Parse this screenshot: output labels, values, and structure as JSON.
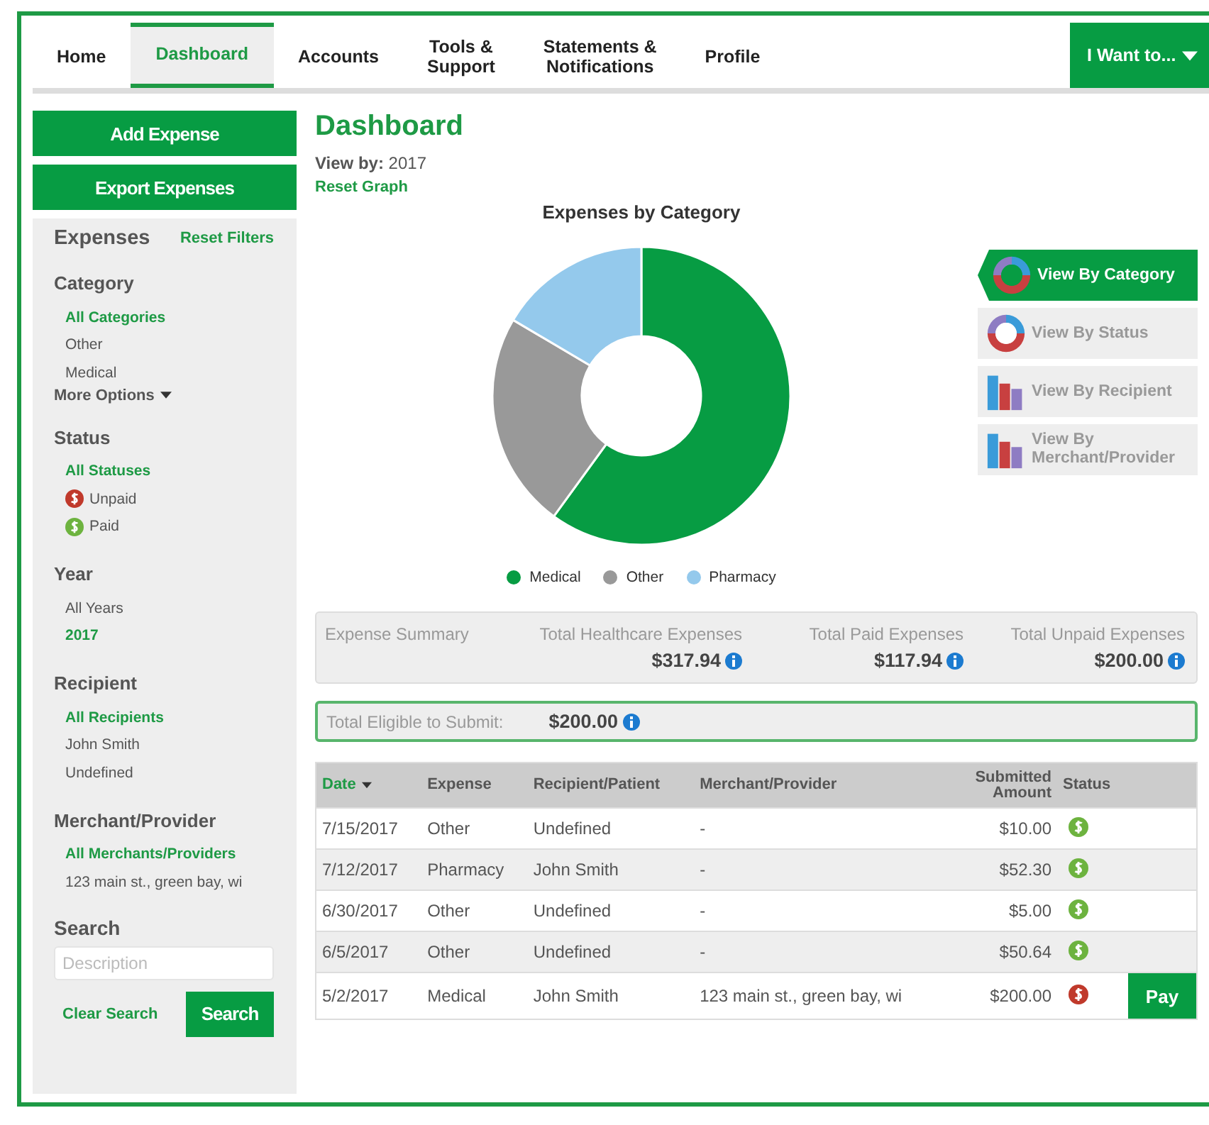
{
  "nav": {
    "tabs": [
      {
        "label": "Home",
        "selected": false
      },
      {
        "label": "Dashboard",
        "selected": true
      },
      {
        "label": "Accounts",
        "selected": false
      },
      {
        "label": "Tools &\nSupport",
        "selected": false
      },
      {
        "label": "Statements &\nNotifications",
        "selected": false
      },
      {
        "label": "Profile",
        "selected": false
      }
    ],
    "menu_button": "I Want to..."
  },
  "sidebar": {
    "actions": [
      "Add Expense",
      "Export Expenses"
    ],
    "title": "Expenses",
    "reset": "Reset Filters",
    "groups": [
      {
        "title": "Category",
        "items": [
          {
            "label": "All Categories",
            "selected": true
          },
          {
            "label": "Other",
            "selected": false
          },
          {
            "label": "Medical",
            "selected": false
          }
        ],
        "more": "More Options"
      },
      {
        "title": "Status",
        "items": [
          {
            "label": "All Statuses",
            "selected": true,
            "kind": "plain"
          },
          {
            "label": "Unpaid",
            "selected": false,
            "kind": "unpaid"
          },
          {
            "label": "Paid",
            "selected": false,
            "kind": "paid"
          }
        ]
      },
      {
        "title": "Year",
        "items": [
          {
            "label": "All Years",
            "selected": false
          },
          {
            "label": "2017",
            "selected": true
          }
        ]
      },
      {
        "title": "Recipient",
        "items": [
          {
            "label": "All Recipients",
            "selected": true
          },
          {
            "label": "John Smith",
            "selected": false
          },
          {
            "label": "Undefined",
            "selected": false
          }
        ]
      },
      {
        "title": "Merchant/Provider",
        "items": [
          {
            "label": "All Merchants/Providers",
            "selected": true
          },
          {
            "label": "123 main st., green bay, wi",
            "selected": false
          }
        ]
      }
    ],
    "search": {
      "title": "Search",
      "placeholder": "Description",
      "clear": "Clear Search",
      "button": "Search"
    }
  },
  "main": {
    "title": "Dashboard",
    "view_by_label": "View by:",
    "view_by_value": "2017",
    "reset_graph": "Reset Graph",
    "chart": {
      "title": "Expenses by Category",
      "legend": [
        {
          "label": "Medical",
          "color": "#079c43"
        },
        {
          "label": "Other",
          "color": "#999999"
        },
        {
          "label": "Pharmacy",
          "color": "#94c9ec"
        }
      ]
    },
    "views": [
      {
        "label": "View By Category",
        "selected": true,
        "kind": "donut"
      },
      {
        "label": "View By Status",
        "selected": false,
        "kind": "donut"
      },
      {
        "label": "View By Recipient",
        "selected": false,
        "kind": "bars"
      },
      {
        "label": "View By\nMerchant/Provider",
        "selected": false,
        "kind": "bars"
      }
    ],
    "summary": {
      "title": "Expense Summary",
      "items": [
        {
          "label": "Total Healthcare Expenses",
          "value": "$317.94"
        },
        {
          "label": "Total Paid Expenses",
          "value": "$117.94"
        },
        {
          "label": "Total Unpaid Expenses",
          "value": "$200.00"
        }
      ]
    },
    "eligible": {
      "label": "Total Eligible to Submit:",
      "value": "$200.00"
    },
    "table": {
      "columns": [
        "Date",
        "Expense",
        "Recipient/Patient",
        "Merchant/Provider",
        "Submitted\nAmount",
        "Status"
      ],
      "rows": [
        {
          "date": "7/15/2017",
          "expense": "Other",
          "recipient": "Undefined",
          "merchant": "-",
          "amount": "$10.00",
          "kind": "paid"
        },
        {
          "date": "7/12/2017",
          "expense": "Pharmacy",
          "recipient": "John Smith",
          "merchant": "-",
          "amount": "$52.30",
          "kind": "paid"
        },
        {
          "date": "6/30/2017",
          "expense": "Other",
          "recipient": "Undefined",
          "merchant": "-",
          "amount": "$5.00",
          "kind": "paid"
        },
        {
          "date": "6/5/2017",
          "expense": "Other",
          "recipient": "Undefined",
          "merchant": "-",
          "amount": "$50.64",
          "kind": "paid"
        },
        {
          "date": "5/2/2017",
          "expense": "Medical",
          "recipient": "John Smith",
          "merchant": "123 main st., green bay, wi",
          "amount": "$200.00",
          "kind": "unpaid",
          "action": "Pay"
        }
      ]
    }
  }
}
